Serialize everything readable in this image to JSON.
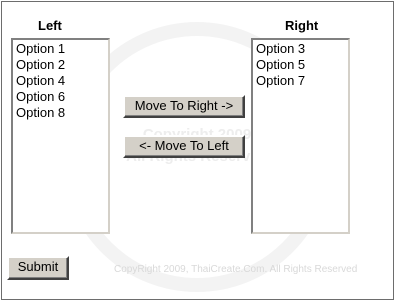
{
  "left": {
    "heading": "Left",
    "options": [
      "Option 1",
      "Option 2",
      "Option 4",
      "Option 6",
      "Option 8"
    ]
  },
  "right": {
    "heading": "Right",
    "options": [
      "Option 3",
      "Option 5",
      "Option 7"
    ]
  },
  "buttons": {
    "move_right": "Move To Right ->",
    "move_left": "<- Move To Left",
    "submit": "Submit"
  },
  "footer": {
    "copyright": "CopyRight 2009, ThaiCreate.Com. All Rights Reserved"
  }
}
